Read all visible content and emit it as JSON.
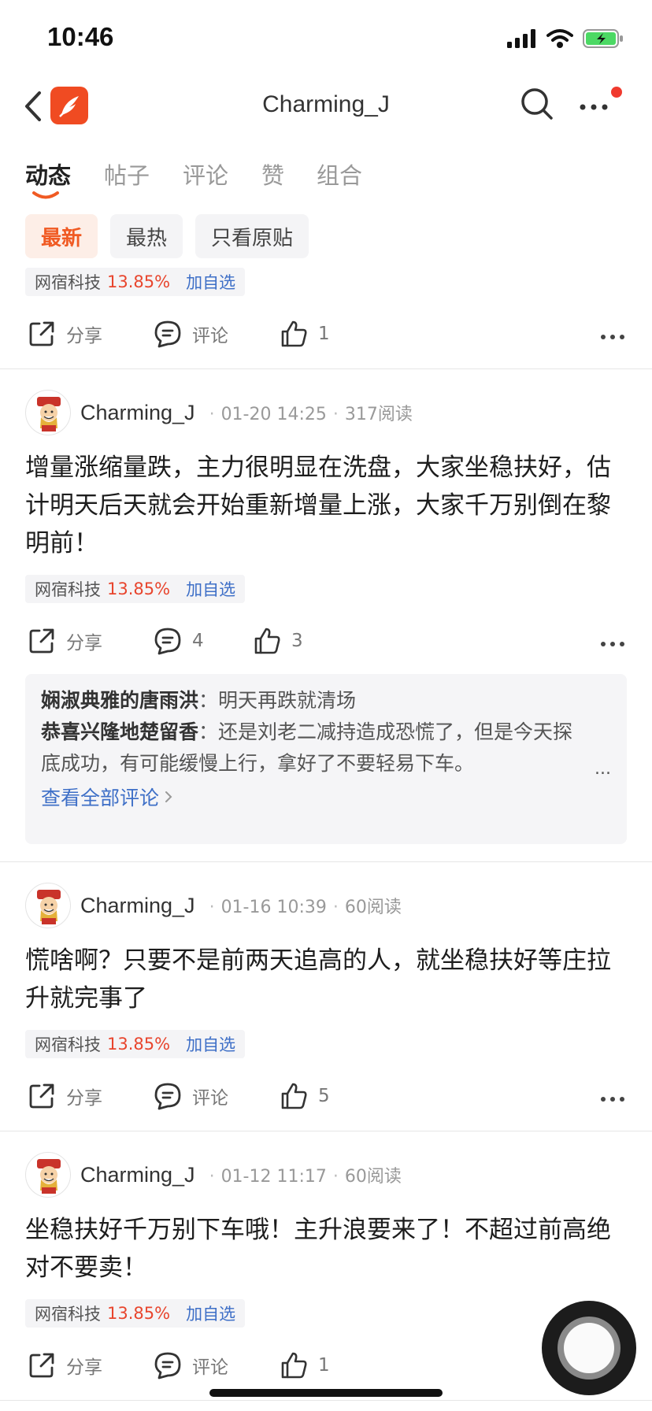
{
  "status_bar": {
    "time": "10:46"
  },
  "nav": {
    "title": "Charming_J"
  },
  "tabs": [
    {
      "label": "动态"
    },
    {
      "label": "帖子"
    },
    {
      "label": "评论"
    },
    {
      "label": "赞"
    },
    {
      "label": "组合"
    }
  ],
  "filters": [
    {
      "label": "最新"
    },
    {
      "label": "最热"
    },
    {
      "label": "只看原贴"
    }
  ],
  "stock_tag": {
    "name": "网宿科技",
    "change": "13.85%",
    "add_label": "加自选"
  },
  "action_labels": {
    "share": "分享",
    "comment": "评论"
  },
  "partial_post": {
    "likes": "1"
  },
  "posts": [
    {
      "author": "Charming_J",
      "date": "01-20 14:25",
      "reads": "317阅读",
      "content": "增量涨缩量跌，主力很明显在洗盘，大家坐稳扶好，估计明天后天就会开始重新增量上涨，大家千万别倒在黎明前！",
      "comment_count": "4",
      "likes": "3",
      "comments": [
        {
          "user": "娴淑典雅的唐雨洪",
          "text": "明天再跌就清场"
        },
        {
          "user": "恭喜兴隆地楚留香",
          "text": "还是刘老二减持造成恐慌了，但是今天探底成功，有可能缓慢上行，拿好了不要轻易下车。"
        }
      ],
      "more_dots": "...",
      "view_all": "查看全部评论"
    },
    {
      "author": "Charming_J",
      "date": "01-16 10:39",
      "reads": "60阅读",
      "content": "慌啥啊？只要不是前两天追高的人，就坐稳扶好等庄拉升就完事了",
      "likes": "5"
    },
    {
      "author": "Charming_J",
      "date": "01-12 11:17",
      "reads": "60阅读",
      "content": "坐稳扶好千万别下车哦！主升浪要来了！不超过前高绝对不要卖！",
      "likes": "1"
    }
  ],
  "colors": {
    "accent": "#f05a23",
    "up": "#e8452d",
    "link": "#3e6fc7"
  }
}
